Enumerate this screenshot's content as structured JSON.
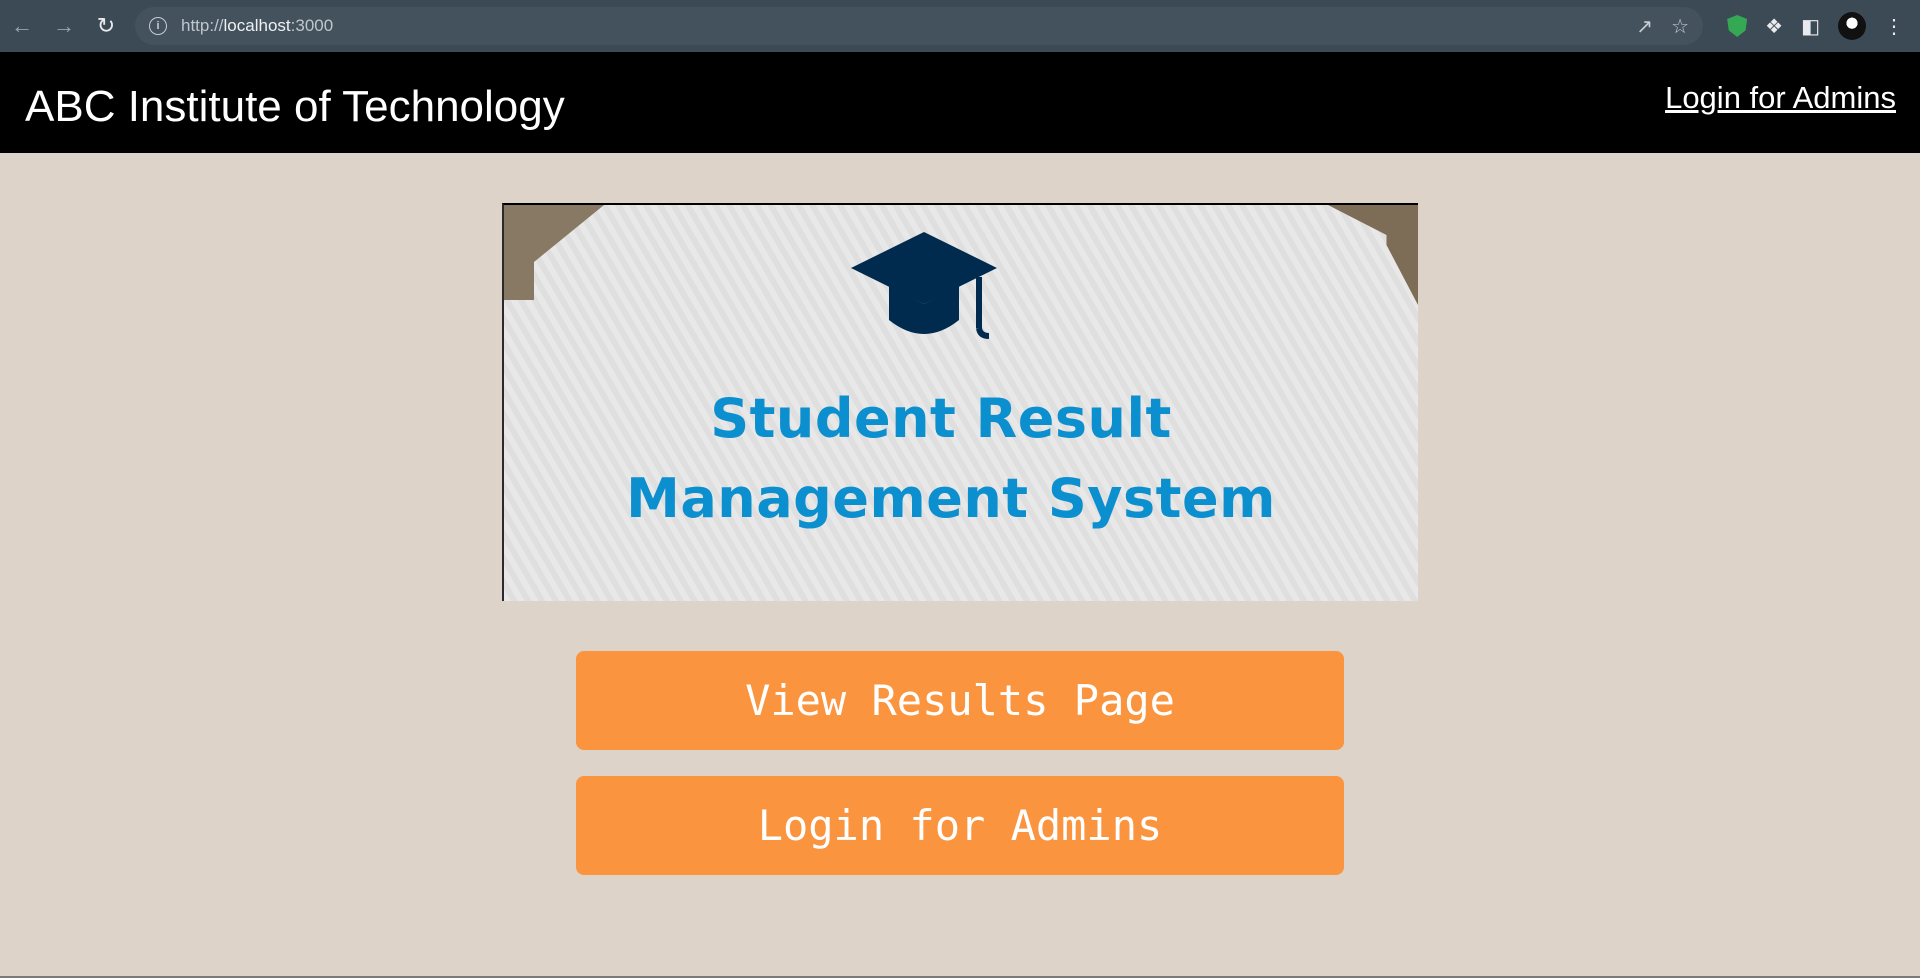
{
  "browser": {
    "url_prefix": "http://",
    "url_host": "localhost",
    "url_port": ":3000"
  },
  "header": {
    "title": "ABC Institute of Technology",
    "admin_link": "Login for Admins"
  },
  "banner": {
    "line1": "Student Result",
    "line2": "Management System"
  },
  "buttons": {
    "view_results": "View Results Page",
    "login_admins": "Login for Admins"
  },
  "colors": {
    "page_bg": "#ddd3c8",
    "button_bg": "#fb943e",
    "header_bg": "#000000",
    "banner_text": "#0b8fcf",
    "cap_color": "#002b4e"
  }
}
